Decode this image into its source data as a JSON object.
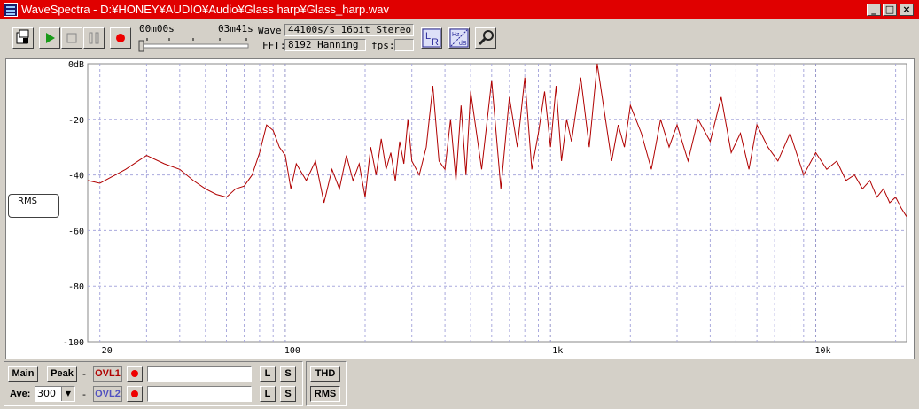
{
  "window": {
    "title": "WaveSpectra - D:¥HONEY¥AUDIO¥Audio¥Glass harp¥Glass_harp.wav",
    "minimize": "_",
    "maximize": "□",
    "close": "×"
  },
  "toolbar": {
    "time_start": "00m00s",
    "time_end": "03m41s",
    "wave_label": "Wave:",
    "wave_value": "44100s/s 16bit Stereo",
    "fft_label": "FFT:",
    "fft_value": "8192 Hanning",
    "fps_label": "fps:",
    "fps_value": "",
    "lr_button": "LR",
    "hz_db_button": "Hz dB",
    "accent_color": "#2c2c9c"
  },
  "chart_data": {
    "type": "line",
    "title": "",
    "xlabel": "",
    "ylabel": "",
    "x_scale": "log",
    "xlim": [
      18,
      22000
    ],
    "ylim": [
      -100,
      0
    ],
    "y_ticks": [
      0,
      -20,
      -40,
      -60,
      -80,
      -100
    ],
    "y_tick_labels": [
      "0dB",
      "-20",
      "-40",
      "-60",
      "-80",
      "-100"
    ],
    "x_tick_labels": [
      {
        "value": 20,
        "label": "20"
      },
      {
        "value": 100,
        "label": "100"
      },
      {
        "value": 1000,
        "label": "1k"
      },
      {
        "value": 10000,
        "label": "10k"
      }
    ],
    "grid": true,
    "line_color": "#b00000",
    "grid_color": "#aaaadd",
    "series": [
      {
        "x": [
          18,
          20,
          25,
          30,
          35,
          40,
          45,
          50,
          55,
          60,
          65,
          70,
          75,
          80,
          85,
          90,
          95,
          100,
          105,
          110,
          120,
          130,
          140,
          150,
          160,
          170,
          180,
          190,
          200,
          210,
          220,
          230,
          240,
          250,
          260,
          270,
          280,
          290,
          300,
          320,
          340,
          360,
          380,
          400,
          420,
          440,
          460,
          480,
          500,
          550,
          600,
          650,
          700,
          750,
          800,
          850,
          900,
          950,
          1000,
          1050,
          1100,
          1150,
          1200,
          1300,
          1400,
          1500,
          1600,
          1700,
          1800,
          1900,
          2000,
          2200,
          2400,
          2600,
          2800,
          3000,
          3300,
          3600,
          4000,
          4400,
          4800,
          5200,
          5600,
          6000,
          6600,
          7200,
          8000,
          9000,
          10000,
          11000,
          12000,
          13000,
          14000,
          15000,
          16000,
          17000,
          18000,
          19000,
          20000,
          21000,
          22000
        ],
        "y": [
          -42,
          -43,
          -38,
          -33,
          -36,
          -38,
          -42,
          -45,
          -47,
          -48,
          -45,
          -44,
          -40,
          -32,
          -22,
          -24,
          -30,
          -33,
          -45,
          -36,
          -42,
          -35,
          -50,
          -38,
          -45,
          -33,
          -42,
          -36,
          -48,
          -30,
          -40,
          -27,
          -38,
          -32,
          -42,
          -28,
          -36,
          -20,
          -35,
          -40,
          -30,
          -8,
          -35,
          -38,
          -20,
          -42,
          -15,
          -40,
          -10,
          -38,
          -6,
          -45,
          -12,
          -30,
          -5,
          -38,
          -25,
          -10,
          -30,
          -8,
          -35,
          -20,
          -28,
          -5,
          -30,
          0,
          -18,
          -35,
          -22,
          -30,
          -15,
          -25,
          -38,
          -20,
          -30,
          -22,
          -35,
          -20,
          -28,
          -12,
          -32,
          -25,
          -38,
          -22,
          -30,
          -35,
          -25,
          -40,
          -32,
          -38,
          -35,
          -42,
          -40,
          -45,
          -42,
          -48,
          -45,
          -50,
          -48,
          -52,
          -55
        ]
      }
    ]
  },
  "rms_label": "RMS",
  "bottom": {
    "main": "Main",
    "peak": "Peak",
    "dash": "-",
    "ovl1": "OVL1",
    "ovl2": "OVL2",
    "ovl1_color": "#b00000",
    "ovl2_color": "#5050c0",
    "l": "L",
    "s": "S",
    "ave_label": "Ave:",
    "ave_value": "300",
    "thd": "THD",
    "rms": "RMS"
  }
}
